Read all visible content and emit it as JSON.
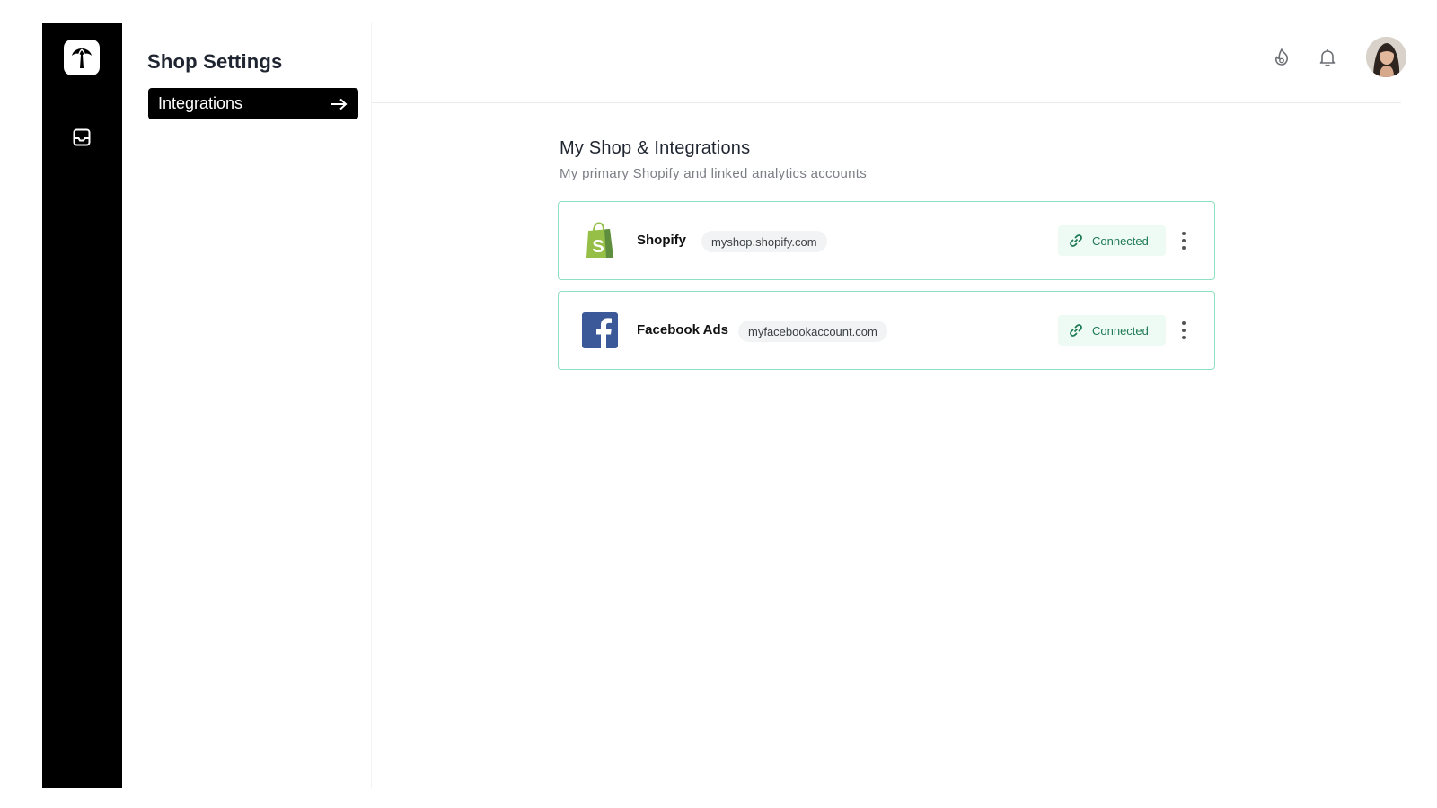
{
  "settings": {
    "title": "Shop Settings",
    "items": [
      {
        "label": "Integrations",
        "active": true
      }
    ]
  },
  "rail": {
    "logo_icon": "palm-tree-icon",
    "items": [
      {
        "icon": "inbox-icon"
      }
    ]
  },
  "topbar": {
    "icons": [
      "fire-icon",
      "bell-icon"
    ],
    "avatar": "user-avatar"
  },
  "main": {
    "title": "My Shop & Integrations",
    "subtitle": "My primary Shopify and linked analytics accounts",
    "integrations": [
      {
        "name": "Shopify",
        "url": "myshop.shopify.com",
        "status": "Connected",
        "logo_icon": "shopify-bag-icon"
      },
      {
        "name": "Facebook Ads",
        "url": "myfacebookaccount.com",
        "status": "Connected",
        "logo_icon": "facebook-icon"
      }
    ]
  },
  "colors": {
    "rail": "#000000",
    "card_border": "#8fe0c0",
    "status_bg": "#eefbf5",
    "status_text": "#1f7a54",
    "shopify_green": "#95bf47",
    "facebook_blue": "#3b5998"
  }
}
